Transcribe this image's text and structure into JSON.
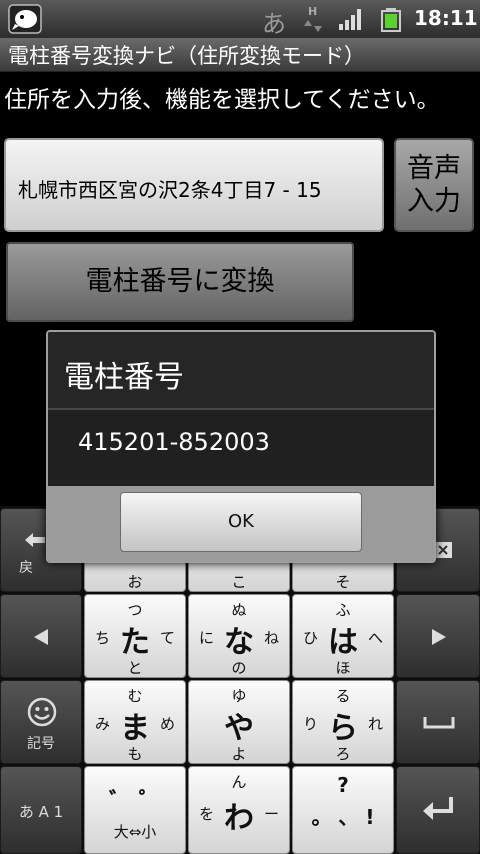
{
  "status_bar": {
    "ime_indicator": "あ",
    "data_indicator": "H",
    "time": "18:11",
    "icons": [
      "app-icon",
      "data-transfer-icon",
      "signal-icon",
      "battery-icon"
    ]
  },
  "app": {
    "title": "電柱番号変換ナビ（住所変換モード）",
    "instruction": "住所を入力後、機能を選択してください。",
    "address_value": "札幌市西区宮の沢2条4丁目7 - 15",
    "voice_button_line1": "音声",
    "voice_button_line2": "入力",
    "convert_button": "電柱番号に変換"
  },
  "dialog": {
    "title": "電柱番号",
    "message": "415201-852003",
    "ok_label": "OK"
  },
  "keyboard": {
    "top_left_label": "戻",
    "top_row": [
      "お",
      "こ",
      "そ"
    ],
    "ta": {
      "center": "た",
      "top": "つ",
      "left": "ち",
      "right": "て",
      "bottom": "と"
    },
    "na": {
      "center": "な",
      "top": "ぬ",
      "left": "に",
      "right": "ね",
      "bottom": "の"
    },
    "ha": {
      "center": "は",
      "top": "ふ",
      "left": "ひ",
      "right": "へ",
      "bottom": "ほ"
    },
    "ma": {
      "center": "ま",
      "top": "む",
      "left": "み",
      "right": "め",
      "bottom": "も"
    },
    "ya": {
      "center": "や",
      "top": "ゆ",
      "bottom": "よ"
    },
    "ra": {
      "center": "ら",
      "top": "る",
      "left": "り",
      "right": "れ",
      "bottom": "ろ"
    },
    "wa": {
      "center": "わ",
      "top": "ん",
      "left": "を",
      "right": "ー"
    },
    "kigou_label": "記号",
    "mode_label": "あ A 1",
    "dakuten_label": "゛ ゜",
    "dakuten_sub": "大⇔小",
    "punct_top": "?",
    "punct_bottom": "。 、 !",
    "colors": {
      "dark_key": "#3e3e3e",
      "light_key": "#e8e8e8"
    }
  }
}
